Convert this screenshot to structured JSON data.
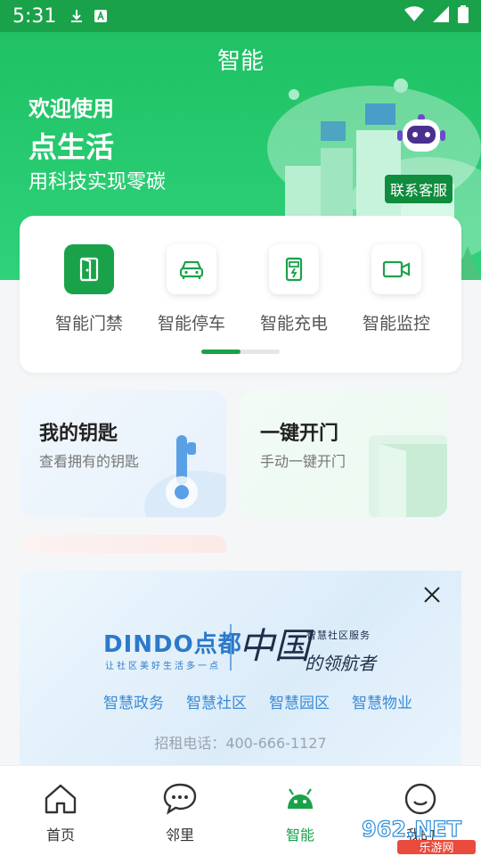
{
  "status_bar": {
    "time": "5:31"
  },
  "header": {
    "title": "智能"
  },
  "banner": {
    "welcome": "欢迎使用",
    "brand": "点生活",
    "slogan": "用科技实现零碳",
    "service_label": "联系客服"
  },
  "functions": [
    {
      "label": "智能门禁",
      "icon": "door-icon"
    },
    {
      "label": "智能停车",
      "icon": "car-icon"
    },
    {
      "label": "智能充电",
      "icon": "charging-pile-icon"
    },
    {
      "label": "智能监控",
      "icon": "video-camera-icon"
    }
  ],
  "quick_cards": [
    {
      "title": "我的钥匙",
      "subtitle": "查看拥有的钥匙"
    },
    {
      "title": "一键开门",
      "subtitle": "手动一键开门"
    }
  ],
  "ad": {
    "logo": "DINDO点都",
    "tagline": "让社区美好生活多一点",
    "china": "中国",
    "service": "智慧社区服务",
    "leader": "的领航者",
    "links": [
      "智慧政务",
      "智慧社区",
      "智慧园区",
      "智慧物业"
    ],
    "phone": "招租电话：400-666-1127"
  },
  "tabs": [
    {
      "label": "首页",
      "icon": "home-icon"
    },
    {
      "label": "邻里",
      "icon": "chat-bubble-icon"
    },
    {
      "label": "智能",
      "icon": "android-robot-icon",
      "active": true
    },
    {
      "label": "我的",
      "icon": "smiley-icon"
    }
  ],
  "watermark": {
    "text": "962.NET",
    "sub": "乐游网"
  },
  "colors": {
    "primary": "#1aa24a",
    "accent_blue": "#2c79c9"
  }
}
